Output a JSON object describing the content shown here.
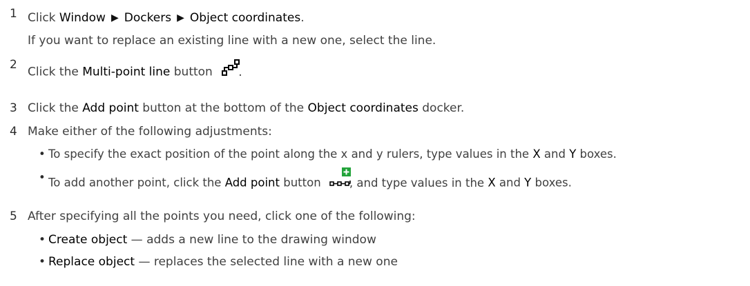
{
  "steps": [
    {
      "num": "1",
      "pre": "Click ",
      "path": [
        "Window",
        "Dockers",
        "Object coordinates"
      ],
      "post": ".",
      "note": "If you want to replace an existing line with a new one, select the line."
    },
    {
      "num": "2",
      "pre": "Click the ",
      "k1": "Multi-point line",
      "mid": " button",
      "post": ".",
      "icon": "multi-point-line-icon"
    },
    {
      "num": "3",
      "pre": "Click the ",
      "k1": "Add point",
      "mid": " button at the bottom of the ",
      "k2": "Object coordinates",
      "post": " docker."
    },
    {
      "num": "4",
      "text": "Make either of the following adjustments:",
      "bullets": [
        {
          "pre": "To specify the exact position of the point along the x and y rulers, type values in the ",
          "k1": "X",
          "mid": " and ",
          "k2": "Y",
          "post": " boxes."
        },
        {
          "pre": "To add another point, click the ",
          "k1": "Add point",
          "mid": " button",
          "mid2": ", and type values in the ",
          "k2": "X",
          "mid3": " and ",
          "k3": "Y",
          "post": " boxes.",
          "icon": "add-point-icon",
          "icon_color": "#22a33a"
        }
      ]
    },
    {
      "num": "5",
      "text": "After specifying all the points you need, click one of the following:",
      "bullets": [
        {
          "k1": "Create object",
          "post": " — adds a new line to the drawing window"
        },
        {
          "k1": "Replace object",
          "post": " — replaces the selected line with a new one"
        }
      ]
    }
  ]
}
